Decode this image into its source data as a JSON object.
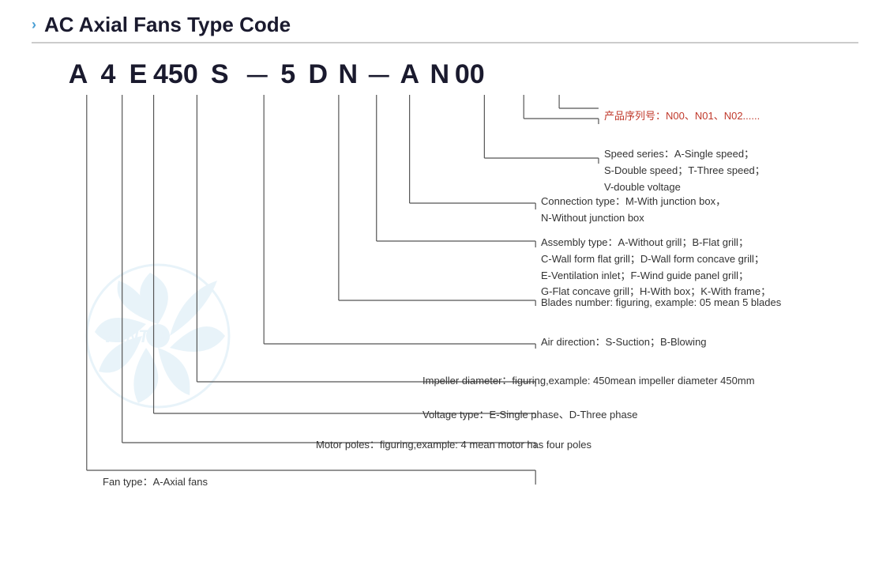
{
  "page": {
    "title": "AC Axial Fans Type Code",
    "chevron": "›"
  },
  "code_sequence": [
    "A",
    "4",
    "E",
    "450",
    "S",
    "—",
    "5",
    "D",
    "N",
    "—",
    "A",
    "N",
    "00"
  ],
  "descriptions": [
    {
      "id": "product-series",
      "text_zh": "产品序列号：N00、N01、N02......",
      "text_en": ""
    },
    {
      "id": "speed-series",
      "label": "Speed series：",
      "text": "A-Single speed；\nS-Double speed；T-Three speed；\nV-double voltage"
    },
    {
      "id": "connection-type",
      "label": "Connection type：",
      "text": "M-With junction box，\nN-Without junction box"
    },
    {
      "id": "assembly-type",
      "label": "Assembly type：",
      "text": "A-Without grill；B-Flat grill；\nC-Wall form flat grill；D-Wall form concave grill；\nE-Ventilation inlet；F-Wind guide panel grill；\nG-Flat concave grill；H-With box；K-With frame；"
    },
    {
      "id": "blades-number",
      "label": "Blades number：",
      "text": "figuring, example: 05 mean 5 blades"
    },
    {
      "id": "air-direction",
      "label": "Air direction：",
      "text": "S-Suction；B-Blowing"
    },
    {
      "id": "impeller-diameter",
      "label": "Impeller diameter：",
      "text": "figuring,example: 450mean impeller diameter 450mm"
    },
    {
      "id": "voltage-type",
      "label": "Voltage type：",
      "text": "E-Single phase、D-Three phase"
    },
    {
      "id": "motor-poles",
      "label": "Motor poles：",
      "text": "figuring,example: 4 mean motor has four poles"
    },
    {
      "id": "fan-type",
      "label": "Fan type：",
      "text": "A-Axial fans"
    }
  ]
}
